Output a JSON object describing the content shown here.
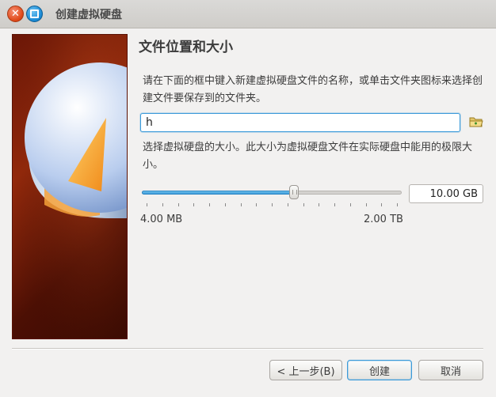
{
  "window": {
    "title": "创建虚拟硬盘",
    "close_icon": "close-icon",
    "maximize_icon": "maximize-icon"
  },
  "page": {
    "heading": "文件位置和大小",
    "location_description": "请在下面的框中键入新建虚拟硬盘文件的名称，或单击文件夹图标来选择创建文件要保存到的文件夹。",
    "file_name_value": "h",
    "folder_icon": "folder-icon",
    "size_description": "选择虚拟硬盘的大小。此大小为虚拟硬盘文件在实际硬盘中能用的极限大小。",
    "size_value": "10.00 GB",
    "slider_level": 0.59,
    "slider_min_label": "4.00 MB",
    "slider_max_label": "2.00 TB"
  },
  "buttons": {
    "back_label": "< 上一步(B)",
    "create_label": "创建",
    "cancel_label": "取消"
  },
  "colors": {
    "accent": "#3b9ad9",
    "close_button": "#e04a1a",
    "side_image_bg": "#7a1c08"
  }
}
